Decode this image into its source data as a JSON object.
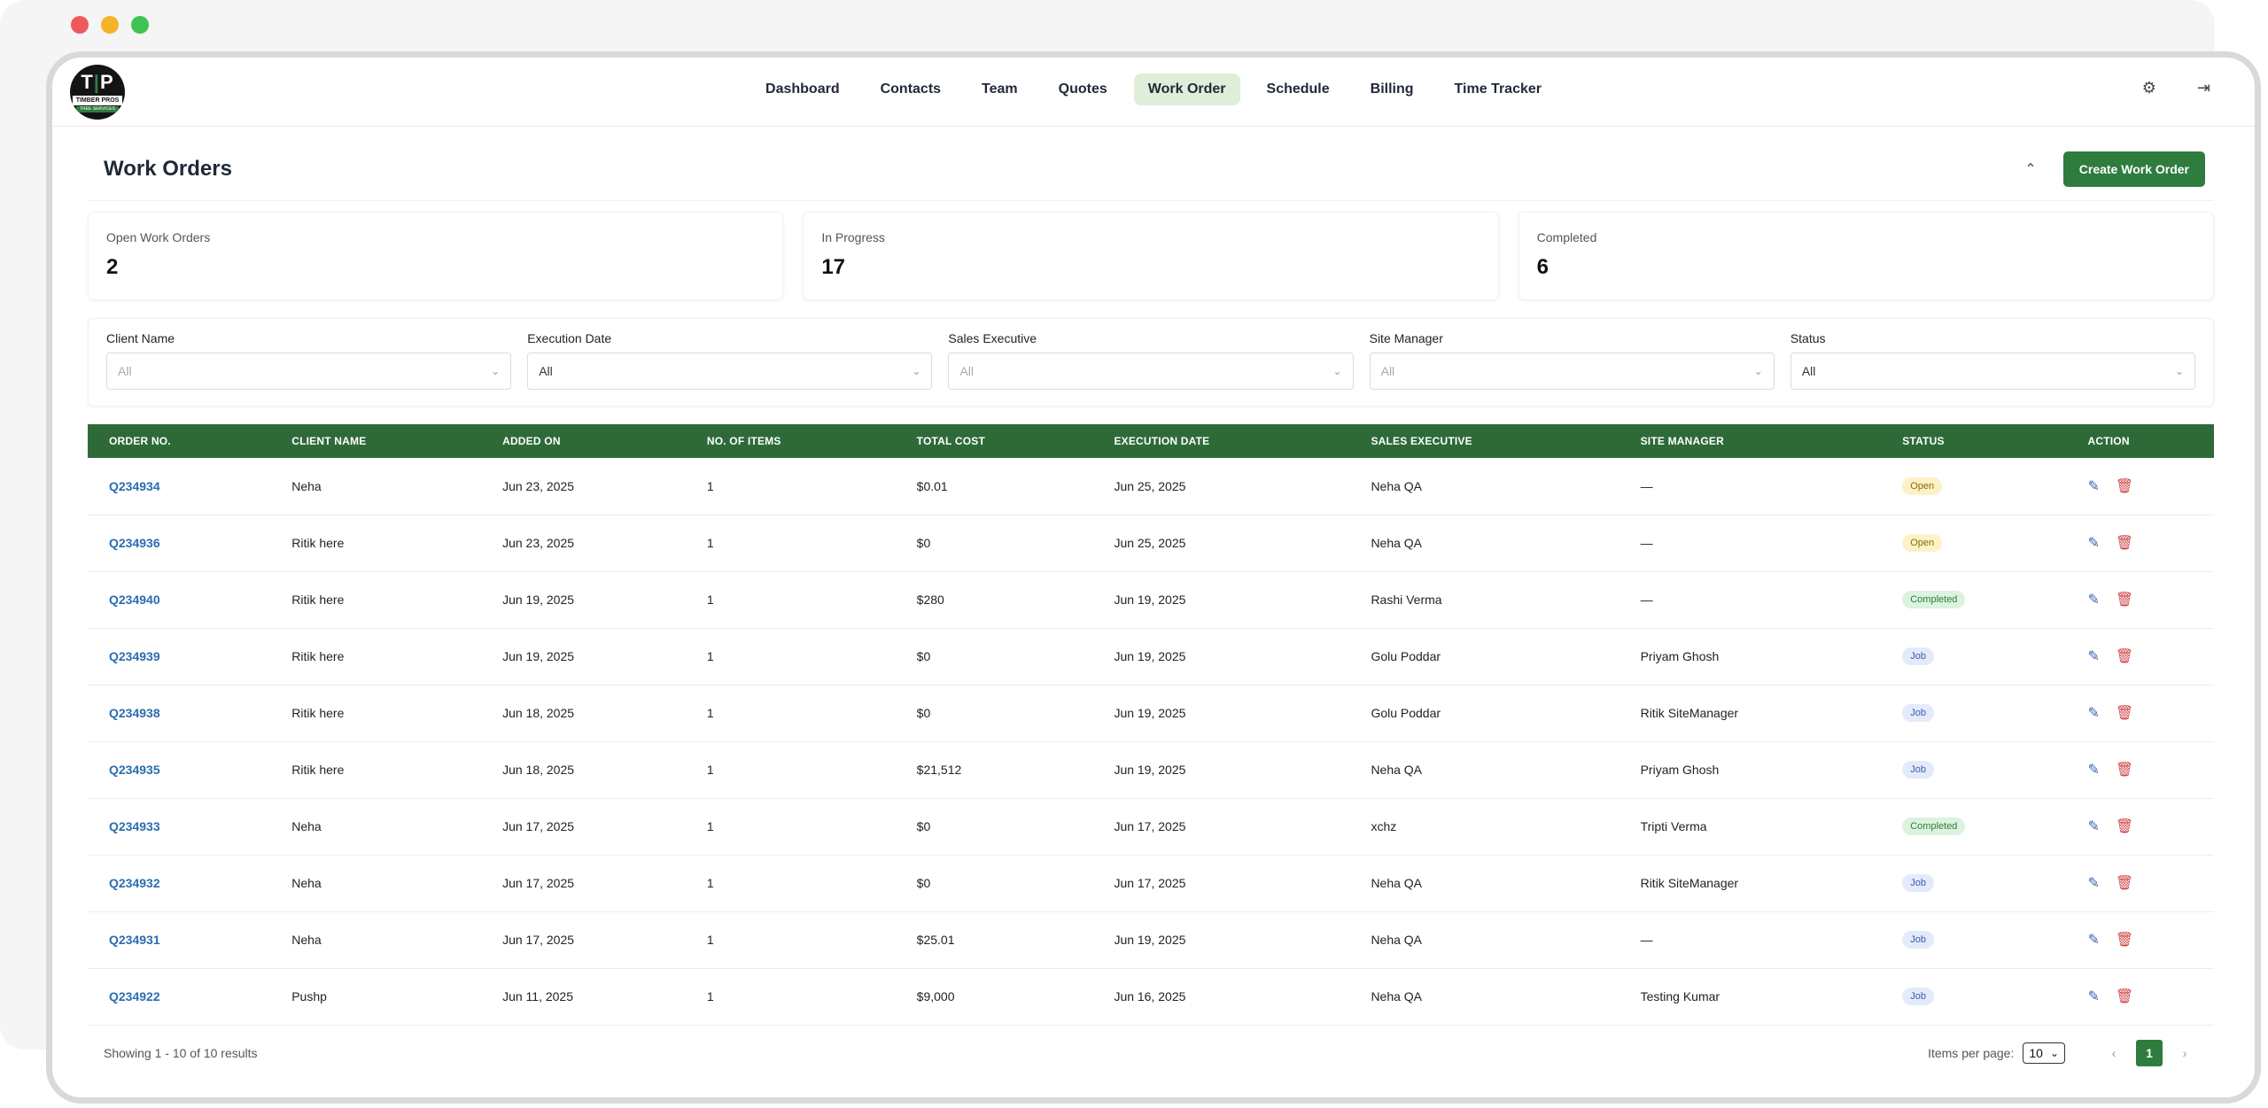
{
  "logo": {
    "mono_left": "T",
    "mono_sep": "|",
    "mono_right": "P",
    "band": "TIMBER PROS",
    "sub": "TREE SERVICES"
  },
  "nav": {
    "items": [
      "Dashboard",
      "Contacts",
      "Team",
      "Quotes",
      "Work Order",
      "Schedule",
      "Billing",
      "Time Tracker"
    ],
    "active": "Work Order"
  },
  "header": {
    "title": "Work Orders",
    "create_label": "Create Work Order"
  },
  "stats": [
    {
      "label": "Open Work Orders",
      "value": "2"
    },
    {
      "label": "In Progress",
      "value": "17"
    },
    {
      "label": "Completed",
      "value": "6"
    }
  ],
  "filters": [
    {
      "label": "Client Name",
      "value": "All"
    },
    {
      "label": "Execution Date",
      "value": "All"
    },
    {
      "label": "Sales Executive",
      "value": "All"
    },
    {
      "label": "Site Manager",
      "value": "All"
    },
    {
      "label": "Status",
      "value": "All"
    }
  ],
  "table": {
    "headers": [
      "ORDER NO.",
      "CLIENT NAME",
      "ADDED ON",
      "NO. OF ITEMS",
      "TOTAL COST",
      "EXECUTION DATE",
      "SALES EXECUTIVE",
      "SITE MANAGER",
      "STATUS",
      "ACTION"
    ],
    "rows": [
      {
        "order": "Q234934",
        "client": "Neha",
        "added": "Jun 23, 2025",
        "items": "1",
        "cost": "$0.01",
        "exec": "Jun 25, 2025",
        "sales": "Neha QA",
        "site": "—",
        "status": "Open"
      },
      {
        "order": "Q234936",
        "client": "Ritik here",
        "added": "Jun 23, 2025",
        "items": "1",
        "cost": "$0",
        "exec": "Jun 25, 2025",
        "sales": "Neha QA",
        "site": "—",
        "status": "Open"
      },
      {
        "order": "Q234940",
        "client": "Ritik here",
        "added": "Jun 19, 2025",
        "items": "1",
        "cost": "$280",
        "exec": "Jun 19, 2025",
        "sales": "Rashi Verma",
        "site": "—",
        "status": "Completed"
      },
      {
        "order": "Q234939",
        "client": "Ritik here",
        "added": "Jun 19, 2025",
        "items": "1",
        "cost": "$0",
        "exec": "Jun 19, 2025",
        "sales": "Golu Poddar",
        "site": "Priyam Ghosh",
        "status": "Job"
      },
      {
        "order": "Q234938",
        "client": "Ritik here",
        "added": "Jun 18, 2025",
        "items": "1",
        "cost": "$0",
        "exec": "Jun 19, 2025",
        "sales": "Golu Poddar",
        "site": "Ritik SiteManager",
        "status": "Job"
      },
      {
        "order": "Q234935",
        "client": "Ritik here",
        "added": "Jun 18, 2025",
        "items": "1",
        "cost": "$21,512",
        "exec": "Jun 19, 2025",
        "sales": "Neha QA",
        "site": "Priyam Ghosh",
        "status": "Job"
      },
      {
        "order": "Q234933",
        "client": "Neha",
        "added": "Jun 17, 2025",
        "items": "1",
        "cost": "$0",
        "exec": "Jun 17, 2025",
        "sales": "xchz",
        "site": "Tripti Verma",
        "status": "Completed"
      },
      {
        "order": "Q234932",
        "client": "Neha",
        "added": "Jun 17, 2025",
        "items": "1",
        "cost": "$0",
        "exec": "Jun 17, 2025",
        "sales": "Neha QA",
        "site": "Ritik SiteManager",
        "status": "Job"
      },
      {
        "order": "Q234931",
        "client": "Neha",
        "added": "Jun 17, 2025",
        "items": "1",
        "cost": "$25.01",
        "exec": "Jun 19, 2025",
        "sales": "Neha QA",
        "site": "—",
        "status": "Job"
      },
      {
        "order": "Q234922",
        "client": "Pushp",
        "added": "Jun 11, 2025",
        "items": "1",
        "cost": "$9,000",
        "exec": "Jun 16, 2025",
        "sales": "Neha QA",
        "site": "Testing Kumar",
        "status": "Job"
      }
    ]
  },
  "footer": {
    "info": "Showing 1 - 10 of 10 results",
    "per_page_label": "Items per page:",
    "per_page_value": "10",
    "current_page": "1"
  },
  "colors": {
    "brand": "#2e7d3e",
    "header_bg": "#2d6a38",
    "link": "#2b6cb0"
  }
}
